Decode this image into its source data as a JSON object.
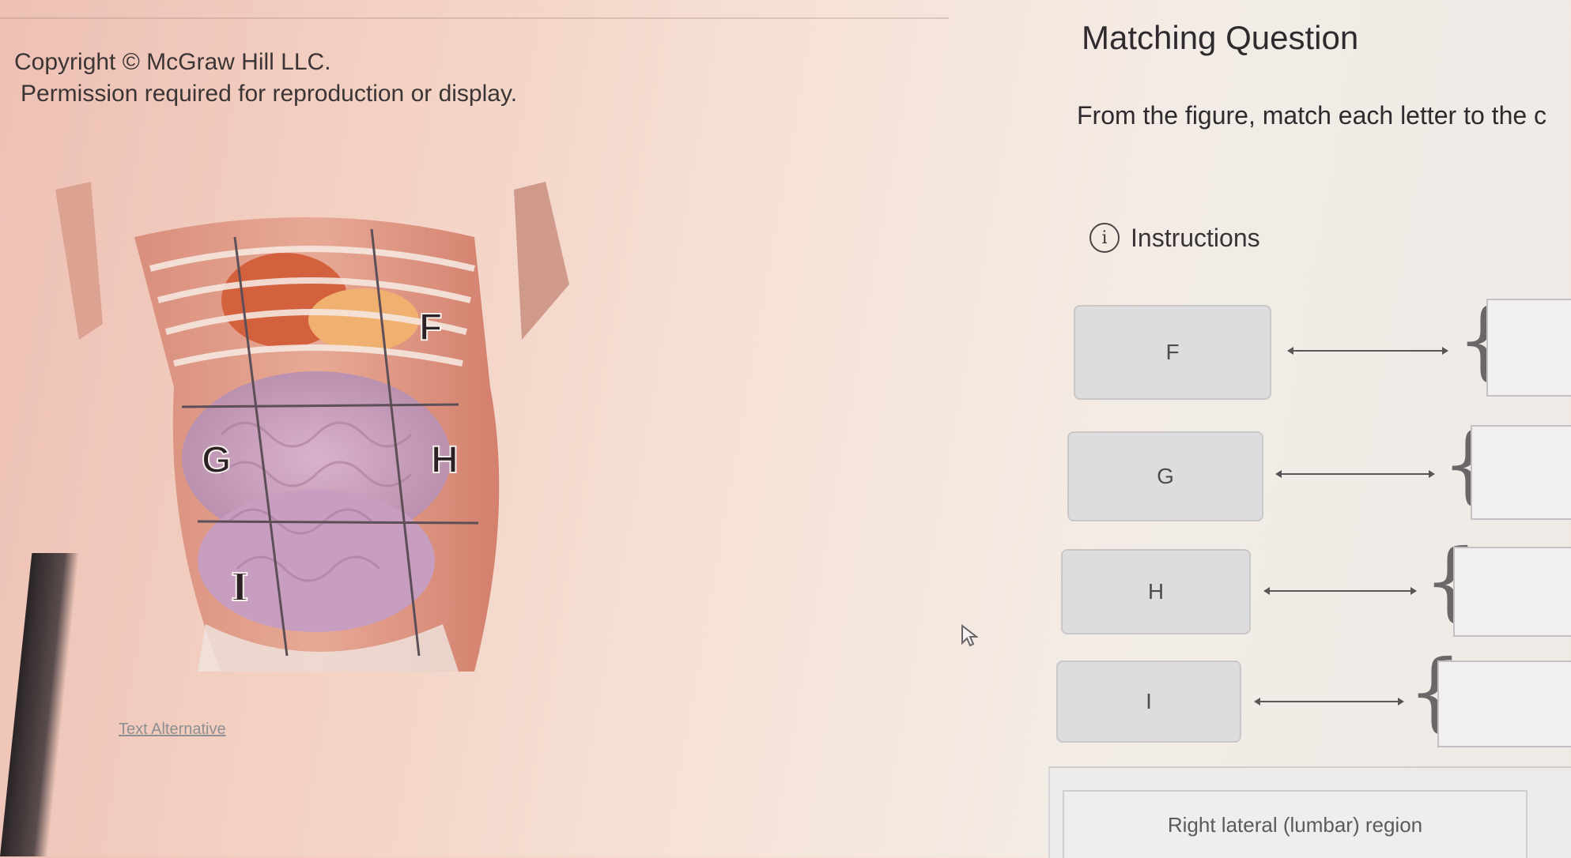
{
  "figure_credit": {
    "copyright": "Copyright © McGraw Hill LLC.",
    "permission": "Permission required for reproduction or display."
  },
  "figure": {
    "labels": [
      "F",
      "G",
      "H",
      "I"
    ],
    "text_alternative_link": "Text Alternative"
  },
  "question": {
    "title": "Matching Question",
    "prompt": "From the figure, match each letter to the c",
    "instructions_label": "Instructions"
  },
  "matching_items": [
    {
      "letter": "F"
    },
    {
      "letter": "G"
    },
    {
      "letter": "H"
    },
    {
      "letter": "I"
    }
  ],
  "answer_bank": [
    "Right lateral (lumbar) region"
  ]
}
